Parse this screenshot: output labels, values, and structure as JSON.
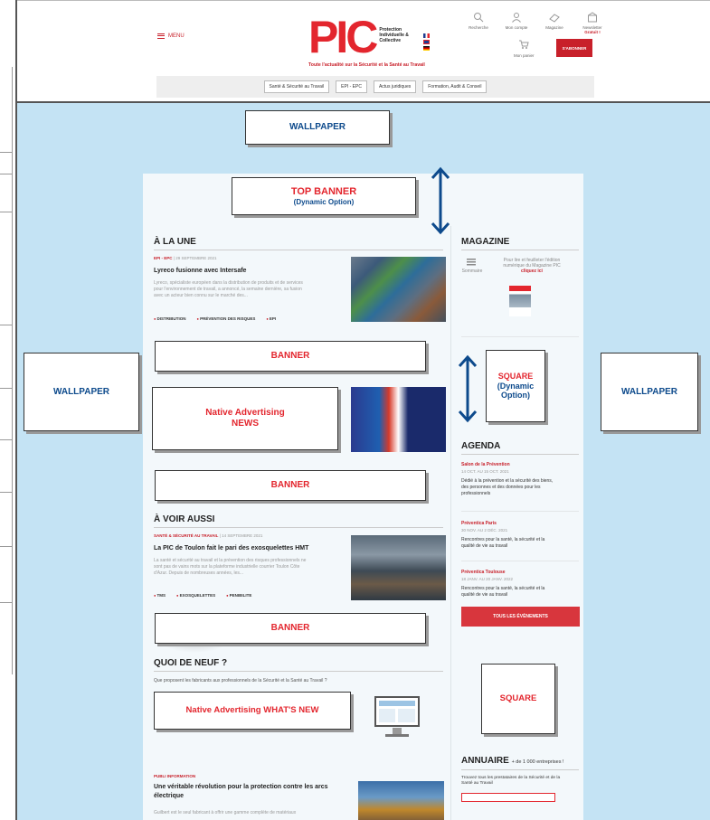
{
  "header": {
    "menu_label": "MENU",
    "logo_letters": "PIC",
    "logo_subtitle": "Protection Individuelle & Collective",
    "tagline": "Toute l'actualité sur la Sécurité et la Santé au Travail",
    "tools": [
      {
        "label": "Recherche",
        "icon": "search-icon"
      },
      {
        "label": "Mon compte",
        "icon": "user-icon"
      },
      {
        "label": "Magazine",
        "icon": "magazine-icon"
      },
      {
        "label": "Newsletter",
        "icon": "newsletter-icon"
      }
    ],
    "gratuit_label": "Gratuit !",
    "cart_label": "Mon panier",
    "subscribe_label": "S'ABONNER",
    "nav": [
      "Santé & Sécurité au Travail",
      "EPI - EPC",
      "Actus juridiques",
      "Formation, Audit & Conseil"
    ]
  },
  "callouts": {
    "wallpaper_top": "WALLPAPER",
    "wallpaper_left": "WALLPAPER",
    "wallpaper_right": "WALLPAPER",
    "top_banner": "TOP BANNER",
    "top_banner_option": "(Dynamic Option)",
    "banner_1": "BANNER",
    "banner_2": "BANNER",
    "banner_3": "BANNER",
    "native_news_1": "Native Advertising",
    "native_news_2": "NEWS",
    "native_whatsnew": "Native Advertising WHAT'S NEW",
    "square_dynamic_1": "SQUARE",
    "square_dynamic_2": "(Dynamic",
    "square_dynamic_3": "Option)",
    "square": "SQUARE"
  },
  "main": {
    "a_la_une": {
      "title": "À LA UNE",
      "category": "EPI - EPC",
      "date": "29 SEPTEMBRE 2021",
      "headline": "Lyreco fusionne avec Intersafe",
      "excerpt_1": "Lyreco, spécialiste européen dans la distribution de produits et de services",
      "excerpt_2": "pour l'environnement de travail, a annoncé, la semaine dernière, sa fusion",
      "excerpt_3": "avec un acteur bien connu sur le marché des...",
      "tags": [
        "DISTRIBUTION",
        "PRÉVENTION DES RISQUES",
        "EPI"
      ]
    },
    "a_voir_aussi": {
      "title": "À VOIR AUSSI",
      "category": "SANTÉ & SÉCURITÉ AU TRAVAIL",
      "date": "14 SEPTEMBRE 2021",
      "headline": "La PIC de Toulon fait le pari des exosquelettes HMT",
      "excerpt_1": "La santé et sécurité au travail et la prévention des risques professionnels ne",
      "excerpt_2": "sont pas de vains mots sur la plateforme industrielle courrier Toulon Côte",
      "excerpt_3": "d'Azur. Depuis de nombreuses années, les...",
      "tags": [
        "TMS",
        "EXOSQUELETTES",
        "PENIBILITE"
      ]
    },
    "quoi_de_neuf": {
      "title": "QUOI DE NEUF ?",
      "subtitle": "Que proposent les fabricants aux professionnels de la Sécurité et la Santé au Travail ?"
    },
    "publi": {
      "category": "PUBLI INFORMATION",
      "headline_1": "Une véritable révolution pour la protection contre les arcs",
      "headline_2": "électrique",
      "excerpt": "Guilbert est le seul fabricant à offrir une gamme complète de matériaux"
    }
  },
  "sidebar": {
    "magazine": {
      "title": "MAGAZINE",
      "sommaire": "Sommaire",
      "text_1": "Pour lire et feuilleter l'édition",
      "text_2": "numérique du Magazine PIC",
      "link": "cliquez ici"
    },
    "agenda": {
      "title": "AGENDA",
      "events": [
        {
          "title": "Salon de la Prévention",
          "date": "14 OCT. AU 15 OCT. 2021",
          "desc_1": "Dédié à la prévention et la sécurité des biens,",
          "desc_2": "des personnes et des données pour les",
          "desc_3": "professionnels"
        },
        {
          "title": "Préventica Paris",
          "date": "30 NOV. AU 2 DÉC. 2021",
          "desc_1": "Rencontres pour la santé, la sécurité et la",
          "desc_2": "qualité de vie au travail",
          "desc_3": ""
        },
        {
          "title": "Préventica Toulouse",
          "date": "18 JANV. AU 20 JANV. 2022",
          "desc_1": "Rencontres pour la santé, la sécurité et la",
          "desc_2": "qualité de vie au travail",
          "desc_3": ""
        }
      ],
      "all_events": "TOUS LES ÉVÈNEMENTS"
    },
    "annuaire": {
      "title": "ANNUAIRE",
      "count": "+ de 1 000 entreprises !",
      "text_1": "Trouvez tous les prestataires de la Sécurité et de la",
      "text_2": "Santé au Travail"
    }
  }
}
